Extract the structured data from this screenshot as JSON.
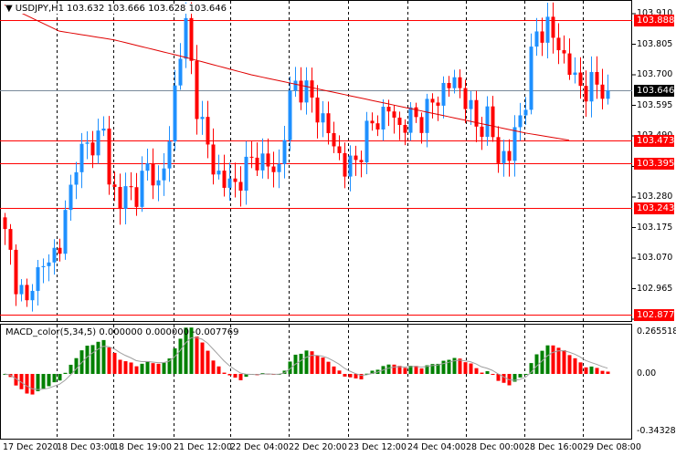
{
  "header": {
    "symbol": "USDJPY,H1",
    "ohlc": "103.632 103.666 103.628 103.646"
  },
  "macd": {
    "title": "MACD_color(5,34,5) 0.000000 0.000000 -0.007769",
    "max_label": "0.265518",
    "zero_label": "0.00",
    "min_label": "-0.343288",
    "range": [
      -0.343288,
      0.265518
    ]
  },
  "colors": {
    "bull": "#1e90ff",
    "bear": "#ff0000",
    "macd_up": "#008000",
    "macd_down": "#ff0000",
    "ma": "#e00000",
    "level": "#ff0000",
    "current": "#000000"
  },
  "chart_data": {
    "type": "candlestick",
    "symbol": "USDJPY",
    "timeframe": "H1",
    "ylim": [
      102.86,
      103.92
    ],
    "y_ticks": [
      "103.910",
      "103.805",
      "103.700",
      "103.595",
      "103.490",
      "103.385",
      "103.280",
      "103.175",
      "103.070",
      "102.965",
      "102.860"
    ],
    "x_ticks": [
      "17 Dec 2020",
      "18 Dec 03:00",
      "18 Dec 19:00",
      "21 Dec 12:00",
      "22 Dec 04:00",
      "22 Dec 20:00",
      "23 Dec 12:00",
      "24 Dec 04:00",
      "28 Dec 00:00",
      "28 Dec 16:00",
      "29 Dec 08:00"
    ],
    "bars": 111,
    "close_path": [
      [
        0,
        103.15
      ],
      [
        2,
        103.0
      ],
      [
        4,
        102.9
      ],
      [
        5,
        103.0
      ],
      [
        8,
        103.06
      ],
      [
        10,
        103.12
      ],
      [
        12,
        103.3
      ],
      [
        13,
        103.42
      ],
      [
        16,
        103.46
      ],
      [
        18,
        103.52
      ],
      [
        19,
        103.32
      ],
      [
        21,
        103.28
      ],
      [
        24,
        103.3
      ],
      [
        26,
        103.38
      ],
      [
        28,
        103.32
      ],
      [
        30,
        103.46
      ],
      [
        31,
        103.65
      ],
      [
        32,
        103.8
      ],
      [
        33,
        103.86
      ],
      [
        35,
        103.6
      ],
      [
        37,
        103.45
      ],
      [
        38,
        103.38
      ],
      [
        40,
        103.33
      ],
      [
        42,
        103.32
      ],
      [
        44,
        103.38
      ],
      [
        46,
        103.42
      ],
      [
        48,
        103.38
      ],
      [
        50,
        103.38
      ],
      [
        51,
        103.5
      ],
      [
        52,
        103.62
      ],
      [
        53,
        103.67
      ],
      [
        55,
        103.64
      ],
      [
        57,
        103.58
      ],
      [
        59,
        103.5
      ],
      [
        61,
        103.42
      ],
      [
        62,
        103.38
      ],
      [
        64,
        103.4
      ],
      [
        66,
        103.5
      ],
      [
        68,
        103.55
      ],
      [
        70,
        103.58
      ],
      [
        72,
        103.52
      ],
      [
        74,
        103.55
      ],
      [
        76,
        103.55
      ],
      [
        78,
        103.6
      ],
      [
        80,
        103.65
      ],
      [
        82,
        103.68
      ],
      [
        84,
        103.62
      ],
      [
        86,
        103.52
      ],
      [
        88,
        103.55
      ],
      [
        90,
        103.42
      ],
      [
        92,
        103.42
      ],
      [
        93,
        103.5
      ],
      [
        95,
        103.62
      ],
      [
        96,
        103.75
      ],
      [
        97,
        103.85
      ],
      [
        99,
        103.86
      ],
      [
        101,
        103.8
      ],
      [
        103,
        103.72
      ],
      [
        104,
        103.68
      ],
      [
        106,
        103.65
      ],
      [
        108,
        103.67
      ],
      [
        110,
        103.646
      ]
    ],
    "ma_path": [
      [
        0,
        103.94
      ],
      [
        10,
        103.85
      ],
      [
        20,
        103.82
      ],
      [
        33,
        103.76
      ],
      [
        45,
        103.7
      ],
      [
        55,
        103.66
      ],
      [
        65,
        103.62
      ],
      [
        75,
        103.58
      ],
      [
        85,
        103.54
      ],
      [
        95,
        103.5
      ],
      [
        103,
        103.475
      ]
    ],
    "levels": [
      {
        "label": "103.888",
        "value": 103.888,
        "type": "resistance"
      },
      {
        "label": "103.646",
        "value": 103.646,
        "type": "current"
      },
      {
        "label": "103.473",
        "value": 103.473,
        "type": "level"
      },
      {
        "label": "103.395",
        "value": 103.395,
        "type": "level"
      },
      {
        "label": "103.243",
        "value": 103.243,
        "type": "level"
      },
      {
        "label": "102.877",
        "value": 102.877,
        "type": "support"
      }
    ]
  }
}
